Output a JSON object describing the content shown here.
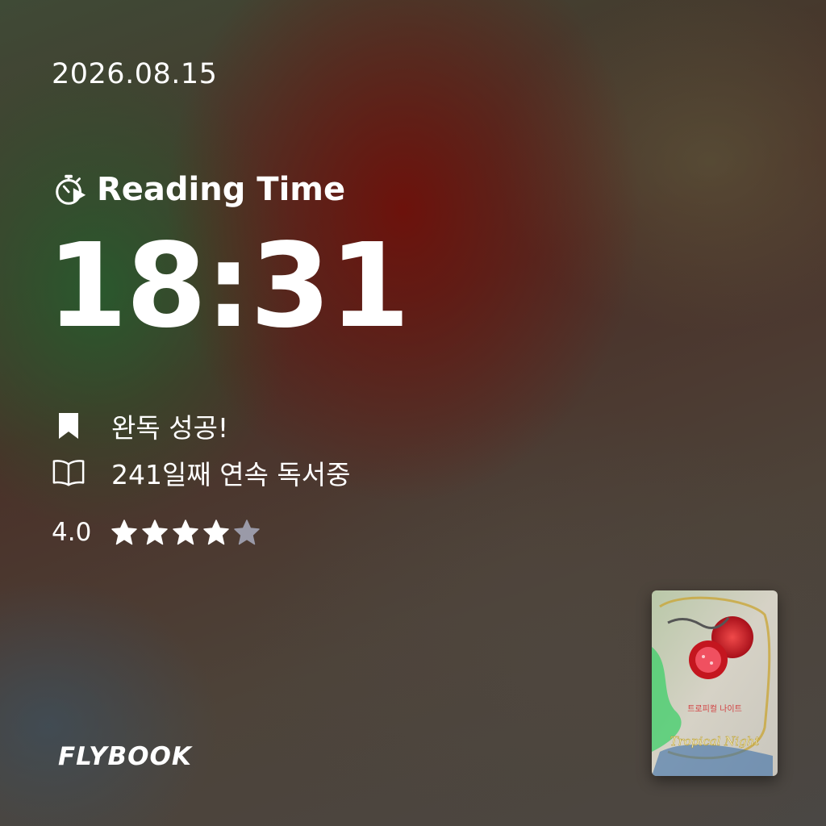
{
  "date": "2026.08.15",
  "reading": {
    "label": "Reading Time",
    "icon": "stopwatch-icon",
    "time": "18:31"
  },
  "status": {
    "completed_label": "완독 성공!",
    "completed_icon": "bookmark-icon",
    "streak_label": "241일째 연속 독서중",
    "streak_icon": "open-book-icon"
  },
  "rating": {
    "value": "4.0",
    "score": 4,
    "max": 5,
    "filled_color": "#ffffff",
    "empty_color": "#9a9aa8"
  },
  "brand": {
    "logo": "FLYBOOK"
  },
  "book": {
    "cover_title": "Tropical Night",
    "cover_title_kr": "트로피컬 나이트"
  }
}
